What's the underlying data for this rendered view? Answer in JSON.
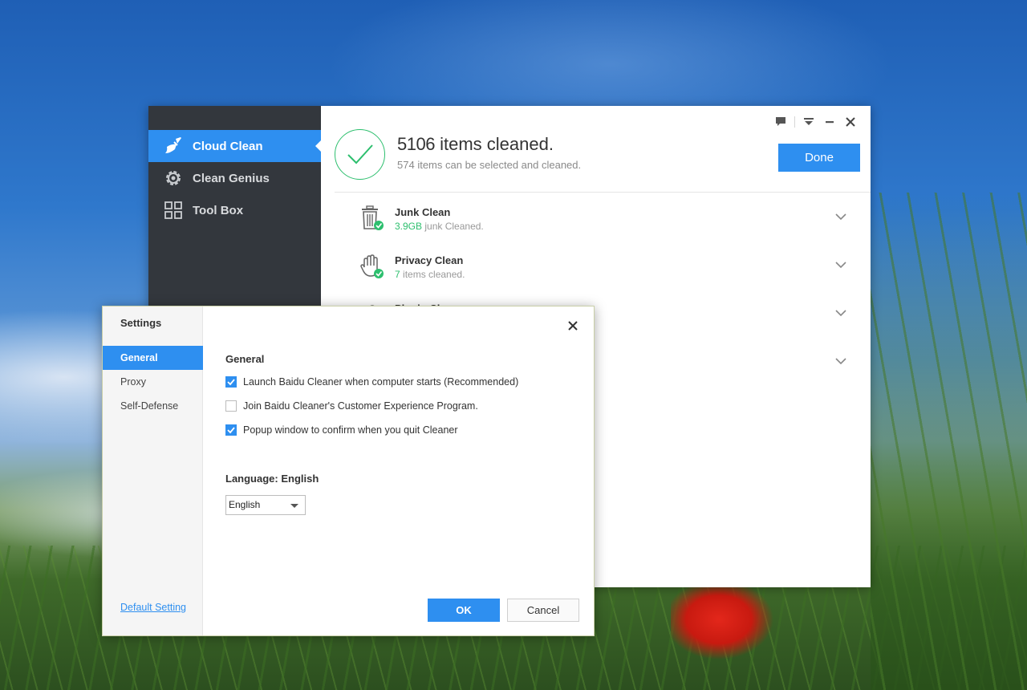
{
  "main_window": {
    "sidebar": {
      "items": [
        {
          "label": "Cloud Clean",
          "icon": "broom-icon",
          "active": true
        },
        {
          "label": "Clean Genius",
          "icon": "gear-icon",
          "active": false
        },
        {
          "label": "Tool Box",
          "icon": "grid-icon",
          "active": false
        }
      ]
    },
    "title_controls": [
      "feedback-icon",
      "menu-icon",
      "minimize-icon",
      "close-icon"
    ],
    "result": {
      "count": "5106",
      "title_suffix": "items cleaned.",
      "subtitle_count": "574",
      "subtitle_suffix": "items can be selected and cleaned.",
      "done_label": "Done"
    },
    "rows": [
      {
        "title": "Junk Clean",
        "highlight": "3.9GB",
        "sub": "junk Cleaned.",
        "icon": "trash-icon"
      },
      {
        "title": "Privacy Clean",
        "highlight": "7",
        "sub": "items cleaned.",
        "icon": "hand-icon"
      },
      {
        "title": "Plugin Clean",
        "highlight": "",
        "sub": "",
        "icon": "plugin-icon"
      },
      {
        "title": "",
        "highlight": "",
        "sub": "",
        "icon": ""
      }
    ]
  },
  "settings": {
    "title": "Settings",
    "tabs": [
      {
        "label": "General",
        "active": true
      },
      {
        "label": "Proxy",
        "active": false
      },
      {
        "label": "Self-Defense",
        "active": false
      }
    ],
    "default_link": "Default Setting",
    "section_title": "General",
    "options": [
      {
        "label": "Launch Baidu Cleaner when computer starts (Recommended)",
        "checked": true
      },
      {
        "label": "Join Baidu Cleaner's Customer Experience Program.",
        "checked": false
      },
      {
        "label": "Popup window to confirm when you quit Cleaner",
        "checked": true
      }
    ],
    "language_label": "Language: English",
    "language_selected": "English",
    "ok_label": "OK",
    "cancel_label": "Cancel"
  },
  "colors": {
    "accent": "#2e8ff0",
    "success": "#2dbf6e",
    "sidebar_bg": "#33373d"
  }
}
